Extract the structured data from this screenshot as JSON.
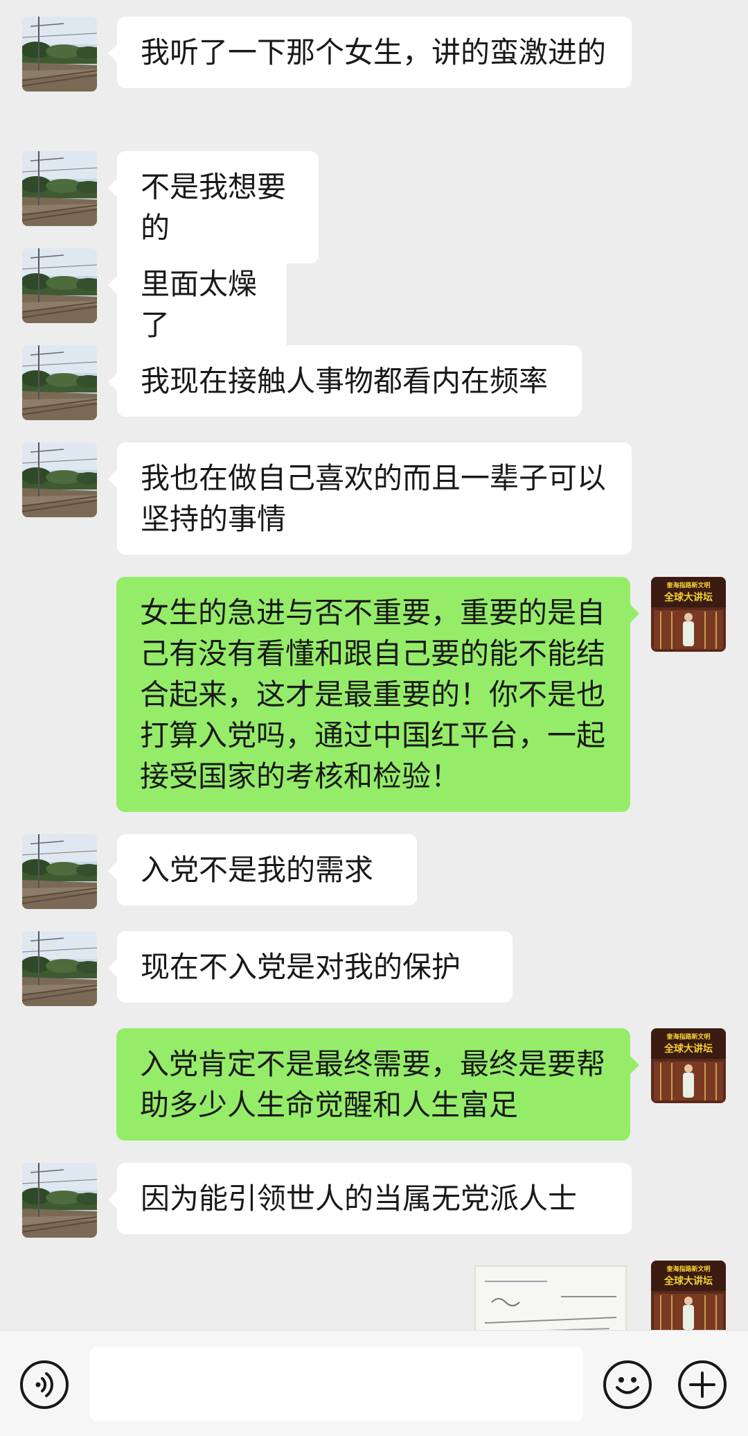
{
  "messages": [
    {
      "side": "left",
      "text": "我听了一下那个女生，讲的蛮激进的"
    },
    {
      "side": "left",
      "text": "不是我想要的"
    },
    {
      "side": "left",
      "text": "里面太燥了"
    },
    {
      "side": "left",
      "text": "我现在接触人事物都看内在频率"
    },
    {
      "side": "left",
      "text": "我也在做自己喜欢的而且一辈子可以坚持的事情"
    },
    {
      "side": "right",
      "text": "女生的急进与否不重要，重要的是自己有没有看懂和跟自己要的能不能结合起来，这才是最重要的！你不是也打算入党吗，通过中国红平台，一起接受国家的考核和检验！"
    },
    {
      "side": "left",
      "text": "入党不是我的需求"
    },
    {
      "side": "left",
      "text": "现在不入党是对我的保护"
    },
    {
      "side": "right",
      "text": "入党肯定不是最终需要，最终是要帮助多少人生命觉醒和人生富足"
    },
    {
      "side": "left",
      "text": "因为能引领世人的当属无党派人士"
    },
    {
      "side": "right",
      "type": "image"
    }
  ],
  "avatars": {
    "contact_icon": "railway-landscape-photo",
    "self_icon": "lecture-banner-photo",
    "self_banner_small": "奎海指路新文明",
    "self_banner_large": "全球大讲坛"
  },
  "input_bar": {
    "placeholder": "",
    "voice_icon": "voice-icon",
    "emoji_icon": "emoji-icon",
    "plus_icon": "plus-icon"
  },
  "colors": {
    "background": "#ededed",
    "incoming_bubble": "#ffffff",
    "outgoing_bubble": "#95ec69",
    "text": "#191919"
  }
}
